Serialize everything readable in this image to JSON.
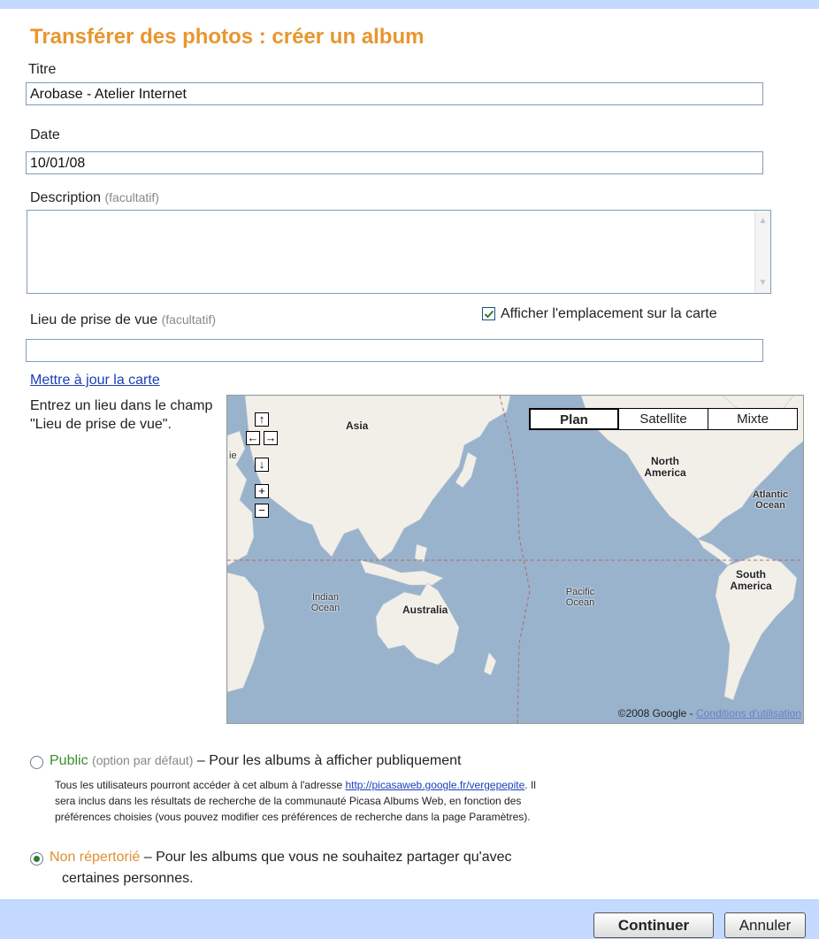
{
  "page": {
    "title": "Transférer des photos : créer un album"
  },
  "form": {
    "title_label": "Titre",
    "title_value": "Arobase - Atelier Internet",
    "date_label": "Date",
    "date_value": "10/01/08",
    "description_label": "Description",
    "description_optional": "(facultatif)",
    "description_value": "",
    "location_label": "Lieu de prise de vue",
    "location_optional": "(facultatif)",
    "location_value": "",
    "show_on_map_label": "Afficher l'emplacement sur la carte",
    "show_on_map_checked": true,
    "update_map_link": "Mettre à jour la carte",
    "map_help": "Entrez un lieu dans le champ \"Lieu de prise de vue\"."
  },
  "map": {
    "type_buttons": [
      "Plan",
      "Satellite",
      "Mixte"
    ],
    "selected_type": "Plan",
    "nav": {
      "up": "↑",
      "left": "←",
      "right": "→",
      "down": "↓",
      "zoom_in": "+",
      "zoom_out": "−"
    },
    "labels": {
      "asia": "Asia",
      "north_america": "North America",
      "south_america": "South America",
      "australia": "Australia",
      "atlantic": "Atlantic Ocean",
      "indian": "Indian Ocean",
      "pacific": "Pacific Ocean",
      "edge": "ie"
    },
    "copyright": "©2008 Google - ",
    "terms_link": "Conditions d'utilisation",
    "colors": {
      "water": "#99b3cc",
      "land": "#f2efe9"
    }
  },
  "visibility": {
    "selected": "non_repertorie",
    "public": {
      "label": "Public",
      "hint": "(option par défaut)",
      "desc": "– Pour les albums à afficher publiquement",
      "detail_line1_a": "Tous les utilisateurs pourront accéder à cet album à l'adresse ",
      "url": "http://picasaweb.google.fr/vergepepite",
      "detail_line1_b": ". Il",
      "detail_line2": "sera inclus dans les résultats de recherche de la communauté Picasa Albums Web, en fonction des",
      "detail_line3": "préférences choisies (vous pouvez modifier ces préférences de recherche dans la page Paramètres)."
    },
    "non_repertorie": {
      "label": "Non répertorié",
      "desc": "– Pour les albums que vous ne souhaitez partager qu'avec",
      "desc_line2": "certaines personnes."
    }
  },
  "buttons": {
    "continue": "Continuer",
    "cancel": "Annuler"
  }
}
